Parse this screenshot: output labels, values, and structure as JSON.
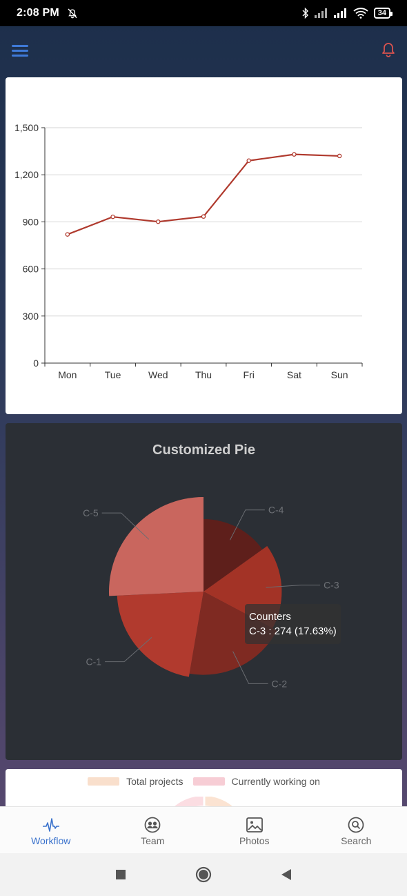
{
  "status_bar": {
    "time": "2:08 PM",
    "battery": "34",
    "icons": [
      "bell-off-icon",
      "bluetooth-icon",
      "signal-icon",
      "signal-icon",
      "wifi-icon",
      "battery-icon"
    ]
  },
  "app_bar": {
    "menu_icon": "menu-icon",
    "notification_icon": "bell-icon",
    "accent_color": "#3f7ad8",
    "bell_color": "#d9534f"
  },
  "line_card": {
    "chart_data": {
      "type": "line",
      "categories": [
        "Mon",
        "Tue",
        "Wed",
        "Thu",
        "Fri",
        "Sat",
        "Sun"
      ],
      "values": [
        820,
        932,
        901,
        934,
        1290,
        1330,
        1320
      ],
      "ylim": [
        0,
        1500
      ],
      "yticks": [
        "0",
        "300",
        "600",
        "900",
        "1,200",
        "1,500"
      ],
      "grid": true,
      "color": "#b03a2e"
    }
  },
  "pie_card": {
    "title": "Customized Pie",
    "chart_data": {
      "type": "pie",
      "style": "rose",
      "labels": [
        "C-4",
        "C-3",
        "C-2",
        "C-1",
        "C-5"
      ],
      "values": [
        235,
        274,
        310,
        335,
        400
      ],
      "colors": [
        "#5e1f1b",
        "#a33326",
        "#7f2a22",
        "#b13a2e",
        "#c9665e"
      ]
    },
    "tooltip": {
      "title": "Counters",
      "text": "C-3 : 274 (17.63%)"
    }
  },
  "bottom_card": {
    "legend": [
      {
        "label": "Total projects",
        "color": "#f9dfcc"
      },
      {
        "label": "Currently working on",
        "color": "#f7cdd5"
      }
    ]
  },
  "bottom_nav": {
    "items": [
      {
        "label": "Workflow",
        "icon": "pulse-icon",
        "active": true
      },
      {
        "label": "Team",
        "icon": "team-icon",
        "active": false
      },
      {
        "label": "Photos",
        "icon": "photos-icon",
        "active": false
      },
      {
        "label": "Search",
        "icon": "search-icon",
        "active": false
      }
    ]
  },
  "system_nav": {
    "icons": [
      "recents-icon",
      "home-icon",
      "back-icon"
    ]
  }
}
